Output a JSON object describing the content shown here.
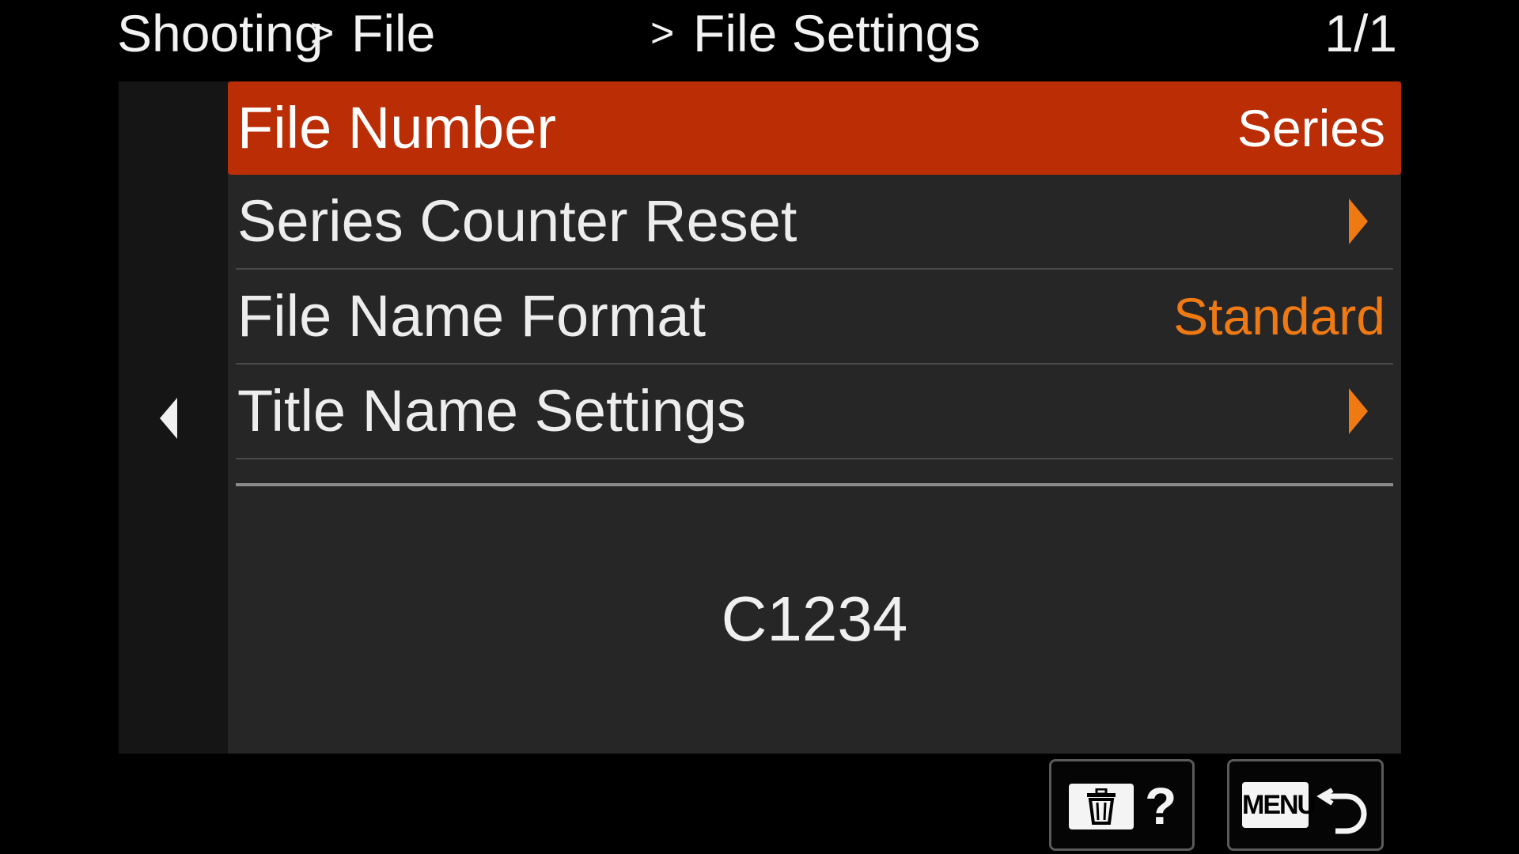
{
  "header": {
    "breadcrumb": [
      "Shooting",
      "File",
      "File Settings"
    ],
    "separator": ">",
    "page_indicator": "1/1"
  },
  "menu": {
    "items": [
      {
        "label": "File Number",
        "value": "Series",
        "selected": true
      },
      {
        "label": "Series Counter Reset",
        "value": "",
        "icon": "chevron-right-icon"
      },
      {
        "label": "File Name Format",
        "value": "Standard"
      },
      {
        "label": "Title Name Settings",
        "value": "",
        "icon": "chevron-right-icon"
      }
    ]
  },
  "preview": {
    "text": "C1234"
  },
  "footer": {
    "delete_help": {
      "icons": [
        "trash-icon",
        "help-icon"
      ],
      "help_glyph": "?"
    },
    "menu_back": {
      "menu_label": "MENU",
      "icon": "return-icon"
    }
  },
  "colors": {
    "selected_bg": "#bb2d05",
    "accent_orange": "#ef7a14",
    "content_bg": "#262626",
    "side_bg": "#151515"
  }
}
